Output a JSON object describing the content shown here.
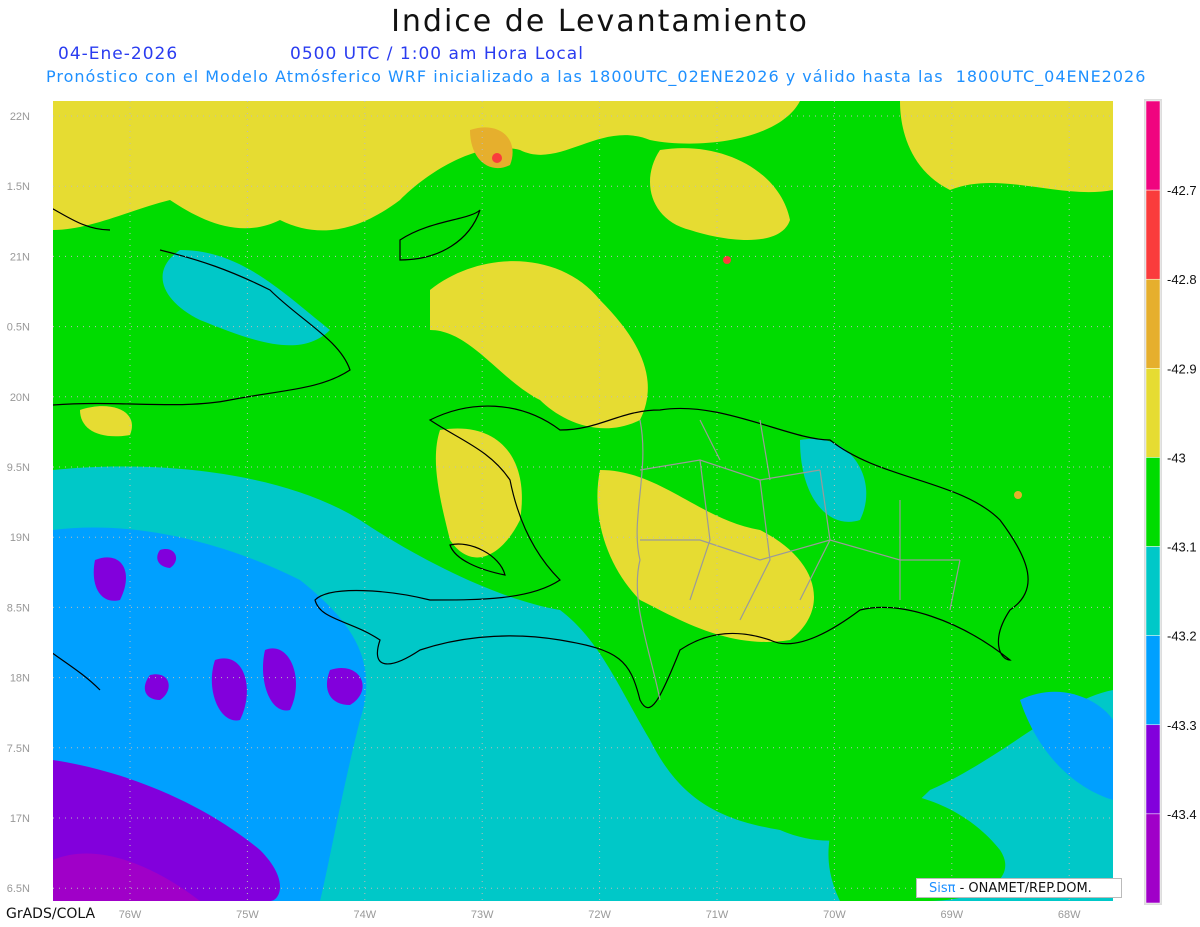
{
  "header": {
    "title": "Indice de Levantamiento",
    "date": "04-Ene-2026",
    "time": "0500 UTC / 1:00 am Hora Local",
    "subtitle": "Pronóstico con el Modelo Atmósferico WRF inicializado a las 1800UTC_02ENE2026 y válido hasta las  1800UTC_04ENE2026"
  },
  "axes": {
    "lat_labels": [
      "22N",
      "1.5N",
      "21N",
      "0.5N",
      "20N",
      "9.5N",
      "19N",
      "8.5N",
      "18N",
      "7.5N",
      "17N",
      "6.5N"
    ],
    "lon_labels": [
      "76W",
      "75W",
      "74W",
      "73W",
      "72W",
      "71W",
      "70W",
      "69W",
      "68W"
    ]
  },
  "colorbar": {
    "colors": [
      "#f0047f",
      "#fa3c3c",
      "#e6af2d",
      "#e6dc32",
      "#00dc00",
      "#00c8c8",
      "#00a0ff",
      "#8200dc",
      "#a000c8"
    ],
    "labels": [
      "-42.7",
      "-42.8",
      "-42.9",
      "-43",
      "-43.1",
      "-43.2",
      "-43.3",
      "-43.4"
    ]
  },
  "footer": {
    "software": "GrADS/COLA",
    "credit_logo": "Sisπ",
    "credit_text": " - ONAMET/REP.DOM."
  }
}
